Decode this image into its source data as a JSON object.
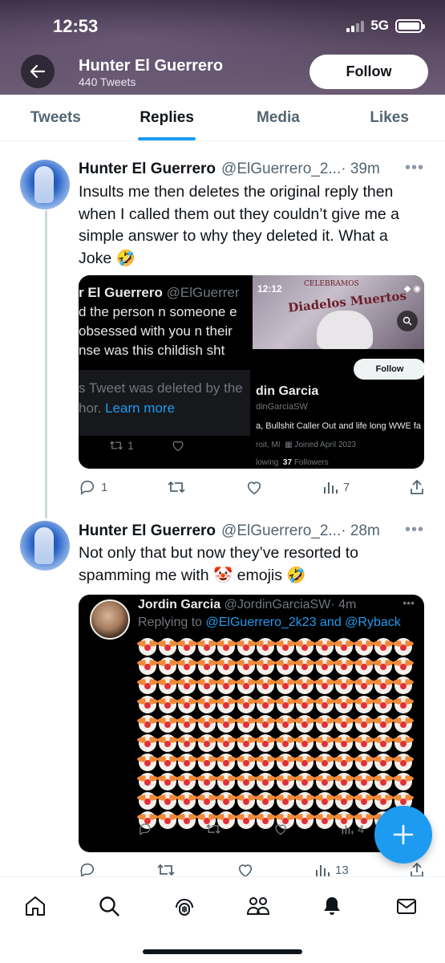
{
  "status_bar": {
    "time": "12:53",
    "network": "5G"
  },
  "header": {
    "name": "Hunter El Guerrero",
    "tweet_count": "440 Tweets",
    "follow_label": "Follow"
  },
  "tabs": [
    {
      "label": "Tweets",
      "active": false
    },
    {
      "label": "Replies",
      "active": true
    },
    {
      "label": "Media",
      "active": false
    },
    {
      "label": "Likes",
      "active": false
    }
  ],
  "tweets": [
    {
      "name": "Hunter El Guerrero",
      "handle": "@ElGuerrero_2...",
      "time": "· 39m",
      "text": "Insults me then deletes the original reply then when I called them out they couldn’t give me a simple answer to why they deleted it. What a Joke 🤣",
      "media": {
        "left": {
          "header_name": "r El Guerrero",
          "header_handle": "@ElGuerrer",
          "line1": "d the person n someone e",
          "line2": "obsessed with you n their",
          "line3": "nse was this childish sht",
          "deleted_line1": "s Tweet was deleted by the",
          "deleted_line2": "hor. ",
          "learn_more": "Learn more",
          "retweets": "1"
        },
        "right": {
          "phone_time": "12:12",
          "cover_small": "CELEBRAMOS",
          "cover_title": "Diadelos Muertos",
          "follow_label": "Follow",
          "name": "din Garcia",
          "handle": "dinGarciaSW",
          "bio": "a, Bullshit Caller Out and life long WWE fa",
          "location": "roit, MI",
          "joined": "Joined April 2023",
          "following_label": "lowing",
          "followers_count": "37",
          "followers_label": "Followers"
        }
      },
      "replies": "1",
      "retweets": "",
      "likes": "",
      "views": "7"
    },
    {
      "name": "Hunter El Guerrero",
      "handle": "@ElGuerrero_2...",
      "time": "· 28m",
      "text": "Not only that but now they’ve resorted to spamming me with 🤡 emojis 🤣",
      "media": {
        "name": "Jordin Garcia",
        "handle": "@JordinGarciaSW",
        "time": "· 4m",
        "replying_prefix": "Replying to ",
        "replying_users": "@ElGuerrero_2k23 and @Ryback",
        "emoji_count": 140,
        "views": "4"
      },
      "replies": "",
      "retweets": "",
      "likes": "",
      "views": "13"
    }
  ],
  "colors": {
    "accent": "#1d9bf0",
    "text": "#0f1419",
    "muted": "#536471"
  }
}
